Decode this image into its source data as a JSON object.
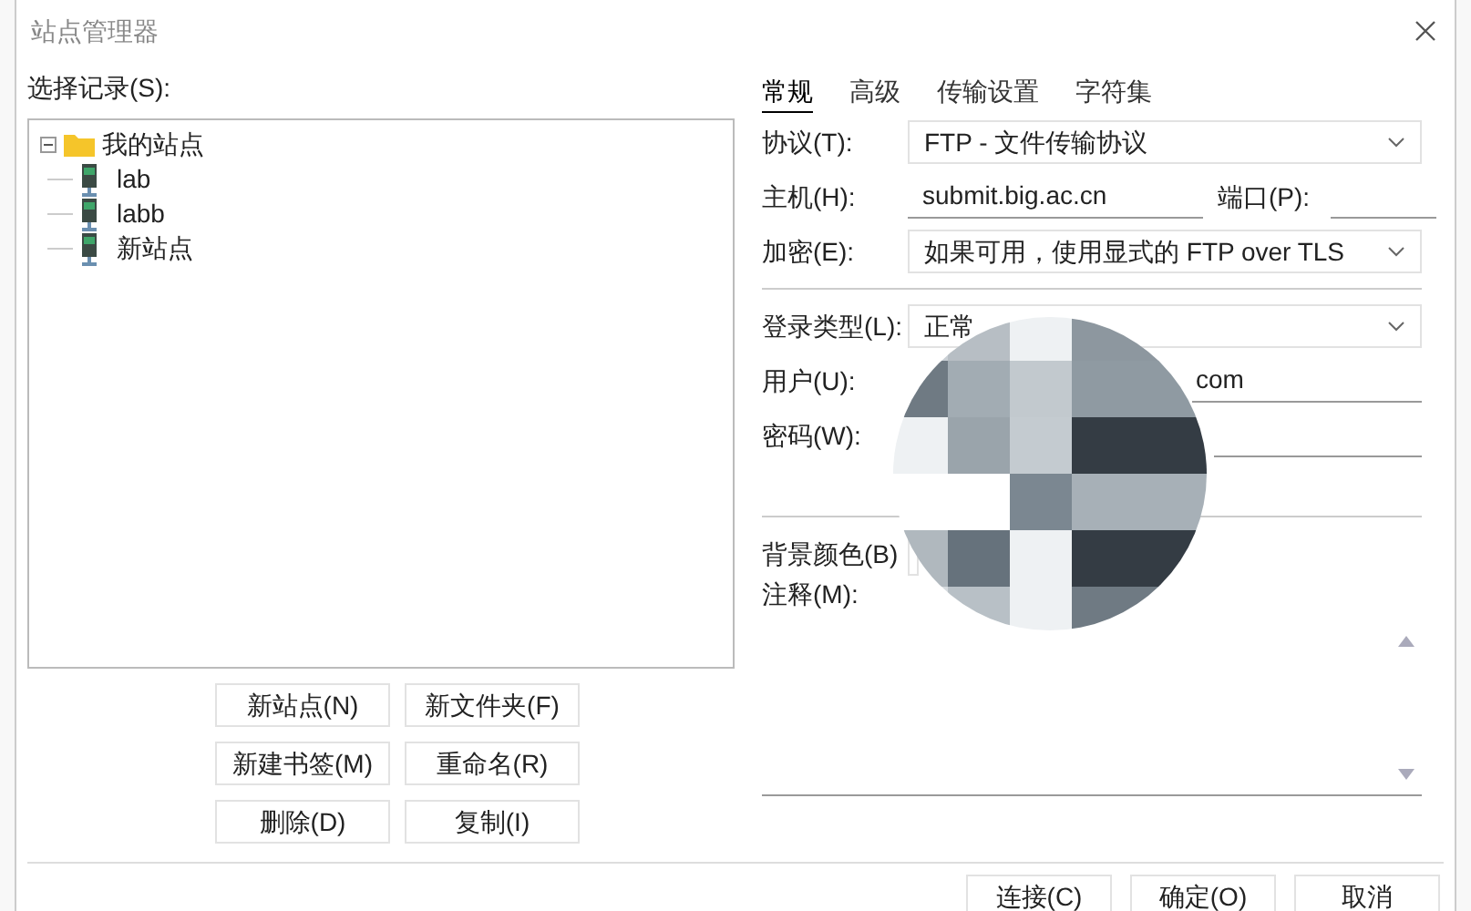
{
  "window": {
    "title": "站点管理器"
  },
  "tree": {
    "label": "选择记录(S):",
    "items": [
      {
        "label": "我的站点",
        "kind": "folder",
        "expanded": true,
        "children": [
          {
            "label": "lab",
            "kind": "site"
          },
          {
            "label": "labb",
            "kind": "site"
          },
          {
            "label": "新站点",
            "kind": "site"
          }
        ]
      }
    ]
  },
  "tree_buttons": [
    "新站点(N)",
    "新文件夹(F)",
    "新建书签(M)",
    "重命名(R)",
    "删除(D)",
    "复制(I)"
  ],
  "tabs": [
    {
      "label": "常规",
      "selected": true
    },
    {
      "label": "高级",
      "selected": false
    },
    {
      "label": "传输设置",
      "selected": false
    },
    {
      "label": "字符集",
      "selected": false
    }
  ],
  "form": {
    "protocol": {
      "label": "协议(T):",
      "value": "FTP - 文件传输协议"
    },
    "host": {
      "label": "主机(H):",
      "value": "submit.big.ac.cn"
    },
    "port": {
      "label": "端口(P):"
    },
    "encryption": {
      "label": "加密(E):",
      "value": "如果可用，使用显式的 FTP over TLS"
    },
    "logon_type": {
      "label": "登录类型(L):",
      "value": "正常"
    },
    "user": {
      "label": "用户(U):",
      "value": "com"
    },
    "password": {
      "label": "密码(W):"
    },
    "background_color": {
      "label": "背景颜色(B)"
    },
    "comments": {
      "label": "注释(M):"
    }
  },
  "buttons": [
    "连接(C)",
    "确定(O)",
    "取消"
  ]
}
